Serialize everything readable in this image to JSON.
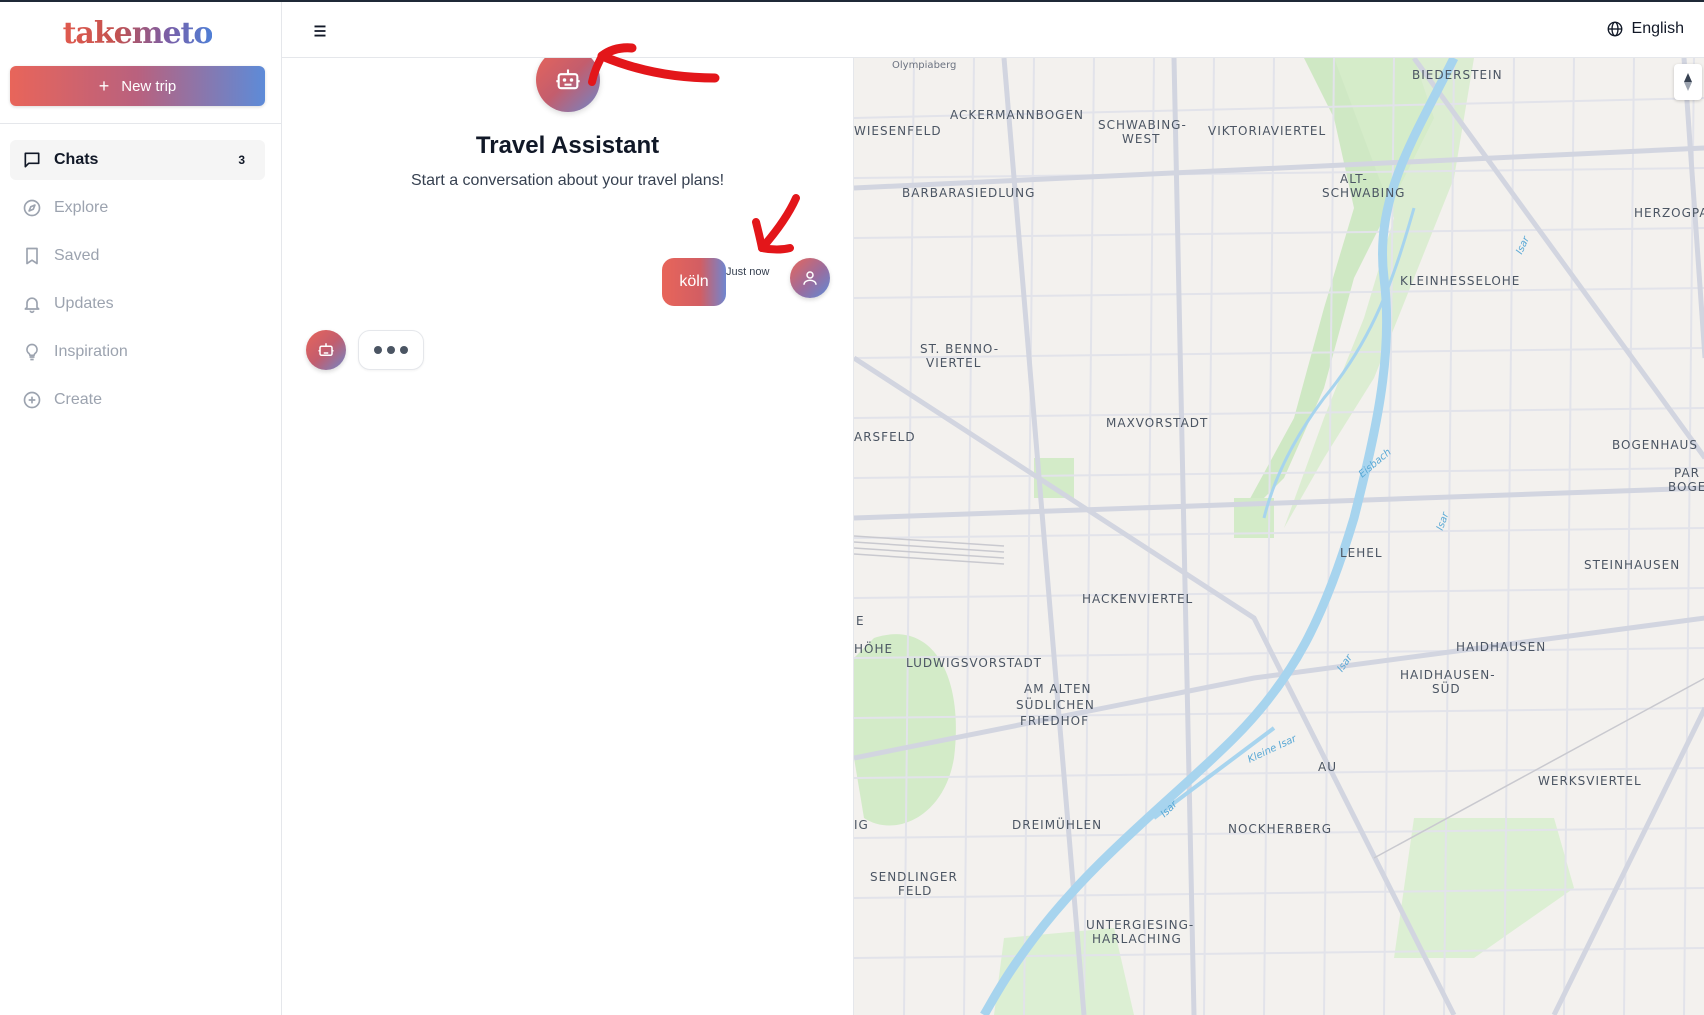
{
  "sidebar": {
    "logo": "takemeto",
    "new_trip_label": "New trip",
    "items": [
      {
        "label": "Chats",
        "count": "3",
        "icon": "chat-bubble-icon"
      },
      {
        "label": "Explore",
        "icon": "compass-icon"
      },
      {
        "label": "Saved",
        "icon": "bookmark-icon"
      },
      {
        "label": "Updates",
        "icon": "bell-icon"
      },
      {
        "label": "Inspiration",
        "icon": "lightbulb-icon"
      },
      {
        "label": "Create",
        "icon": "plus-circle-icon"
      }
    ]
  },
  "header": {
    "menu_icon": "hamburger-menu-icon",
    "language": "English"
  },
  "chat": {
    "title": "Travel Assistant",
    "subtitle": "Start a conversation about your travel plans!",
    "messages": [
      {
        "role": "user",
        "text": "köln",
        "time": "Just now"
      }
    ],
    "typing_indicator": "•••"
  },
  "map": {
    "labels": [
      "Olympiaberg",
      "BIEDERSTEIN",
      "ACKERMANNBOGEN",
      "SCHWABING-",
      "WEST",
      "VIKTORIAVIERTEL",
      "WIESENFELD",
      "ALT-",
      "SCHWABING",
      "HERZOGPAR",
      "BARBARASIEDLUNG",
      "KLEINHESSELOHE",
      "ST. BENNO-",
      "VIERTEL",
      "MAXVORSTADT",
      "ARSFELD",
      "BOGENHAUS",
      "PAR",
      "BOGE",
      "LEHEL",
      "STEINHAUSEN",
      "HACKENVIERTEL",
      "E",
      "HÖHE",
      "HAIDHAUSEN",
      "LUDWIGSVORSTADT",
      "HAIDHAUSEN-",
      "SÜD",
      "AM ALTEN",
      "SÜDLICHEN",
      "FRIEDHOF",
      "AU",
      "WERKSVIERTEL",
      "DREIMÜHLEN",
      "NOCKHERBERG",
      "IG",
      "SENDLINGER",
      "FELD",
      "UNTERGIESING-",
      "HARLACHING",
      "Isar",
      "Eisbach",
      "Kleine Isar"
    ]
  },
  "colors": {
    "accent_start": "#e8655a",
    "accent_end": "#5d8bd8",
    "annotation_red": "#e3161a"
  }
}
